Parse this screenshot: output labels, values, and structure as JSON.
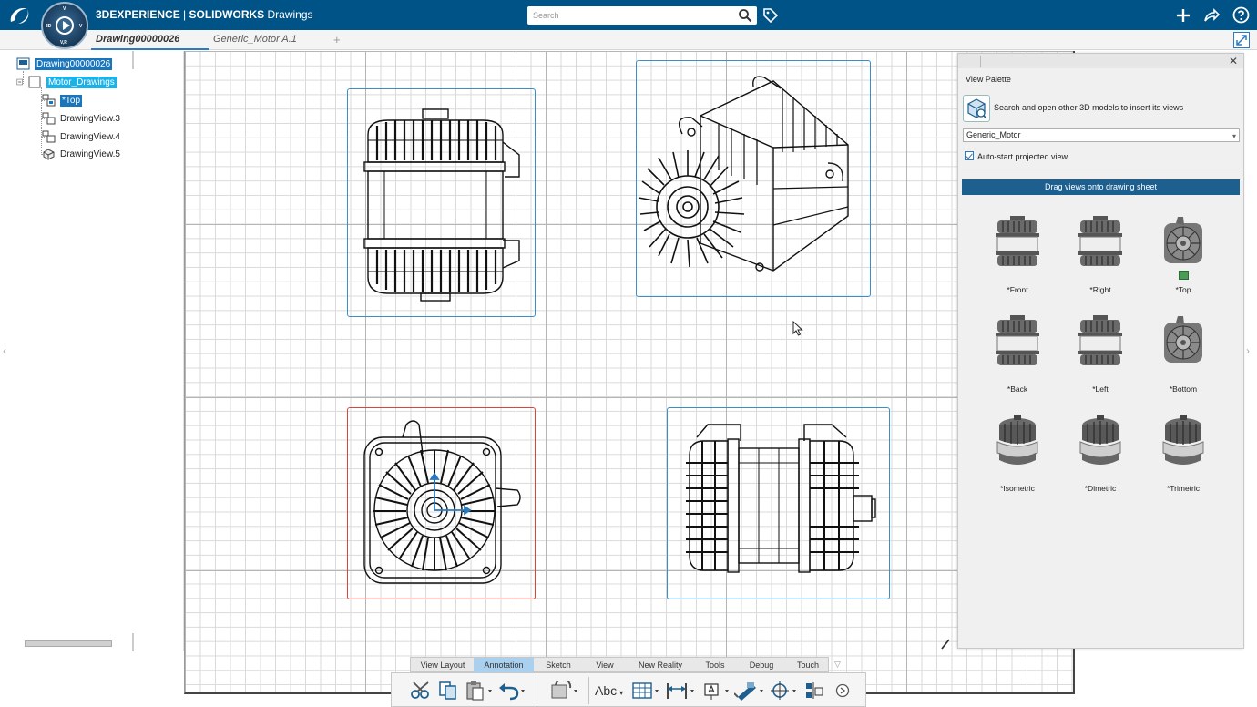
{
  "app": {
    "title_brand": "3DEXPERIENCE",
    "title_sep": " | ",
    "title_app": "SOLIDWORKS",
    "title_module": " Drawings",
    "compass_labels": {
      "top": "V",
      "left": "3D",
      "right": "V",
      "bottom": "V,R"
    }
  },
  "search": {
    "placeholder": "Search"
  },
  "tabs": [
    {
      "label": "Drawing00000026",
      "active": true
    },
    {
      "label": "Generic_Motor A.1",
      "active": false
    }
  ],
  "tree": {
    "root": "Drawing00000026",
    "folder": "Motor_Drawings",
    "items": [
      "*Top",
      "DrawingView.3",
      "DrawingView.4",
      "DrawingView.5"
    ]
  },
  "palette": {
    "title": "View Palette",
    "search_text": "Search and open other 3D models to insert its views",
    "model": "Generic_Motor",
    "auto_label": "Auto-start projected view",
    "auto_checked": true,
    "drag_banner": "Drag views onto drawing sheet",
    "views": [
      "*Front",
      "*Right",
      "*Top",
      "*Back",
      "*Left",
      "*Bottom",
      "*Isometric",
      "*Dimetric",
      "*Trimetric"
    ]
  },
  "toolbar": {
    "tabs": [
      "View Layout",
      "Annotation",
      "Sketch",
      "View",
      "New Reality",
      "Tools",
      "Debug",
      "Touch"
    ],
    "active_tab": "Annotation",
    "buttons": [
      "cut",
      "copy",
      "paste",
      "undo",
      "update",
      "text",
      "table",
      "dimension",
      "annotation",
      "weld",
      "center",
      "balloon",
      "more"
    ],
    "text_button_label": "Abc"
  },
  "colors": {
    "topbar": "#005386",
    "accent": "#1b75bb",
    "active_tab": "#a9d0ee",
    "frame": "#3b8fc8",
    "frame_active": "#d8453f",
    "banner": "#1d5f8f"
  }
}
